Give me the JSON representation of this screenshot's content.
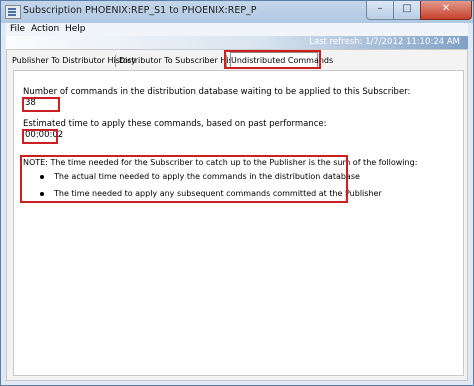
{
  "window": {
    "title": "Subscription PHOENIX:REP_S1 to PHOENIX:REP_P",
    "minimize_glyph": "–",
    "maximize_glyph": "□",
    "close_glyph": "✕"
  },
  "menu": {
    "items": [
      {
        "label": "File"
      },
      {
        "label": "Action"
      },
      {
        "label": "Help"
      }
    ]
  },
  "toolbar": {
    "last_refresh": "Last refresh: 1/7/2012 11:10:24 AM"
  },
  "tabs": [
    {
      "label": "Publisher To Distributor History",
      "active": false
    },
    {
      "label": "Distributor To Subscriber History",
      "active": false
    },
    {
      "label": "Undistributed Commands",
      "active": true
    }
  ],
  "panel": {
    "commands_label": "Number of commands in the distribution database waiting to be applied to this Subscriber:",
    "commands_value": "38",
    "time_label": "Estimated time to apply these commands, based on past performance:",
    "time_value": "00:00:02",
    "note_heading": "NOTE: The time needed for the Subscriber to catch up to the Publisher is the sum of the following:",
    "note_items": [
      "The actual time needed to apply the commands in the distribution database",
      "The time needed to apply any subsequent commands committed at the Publisher"
    ]
  },
  "colors": {
    "highlight": "#cc1f1f",
    "title_bar": "#b9cde4",
    "close_button": "#c7402d"
  }
}
